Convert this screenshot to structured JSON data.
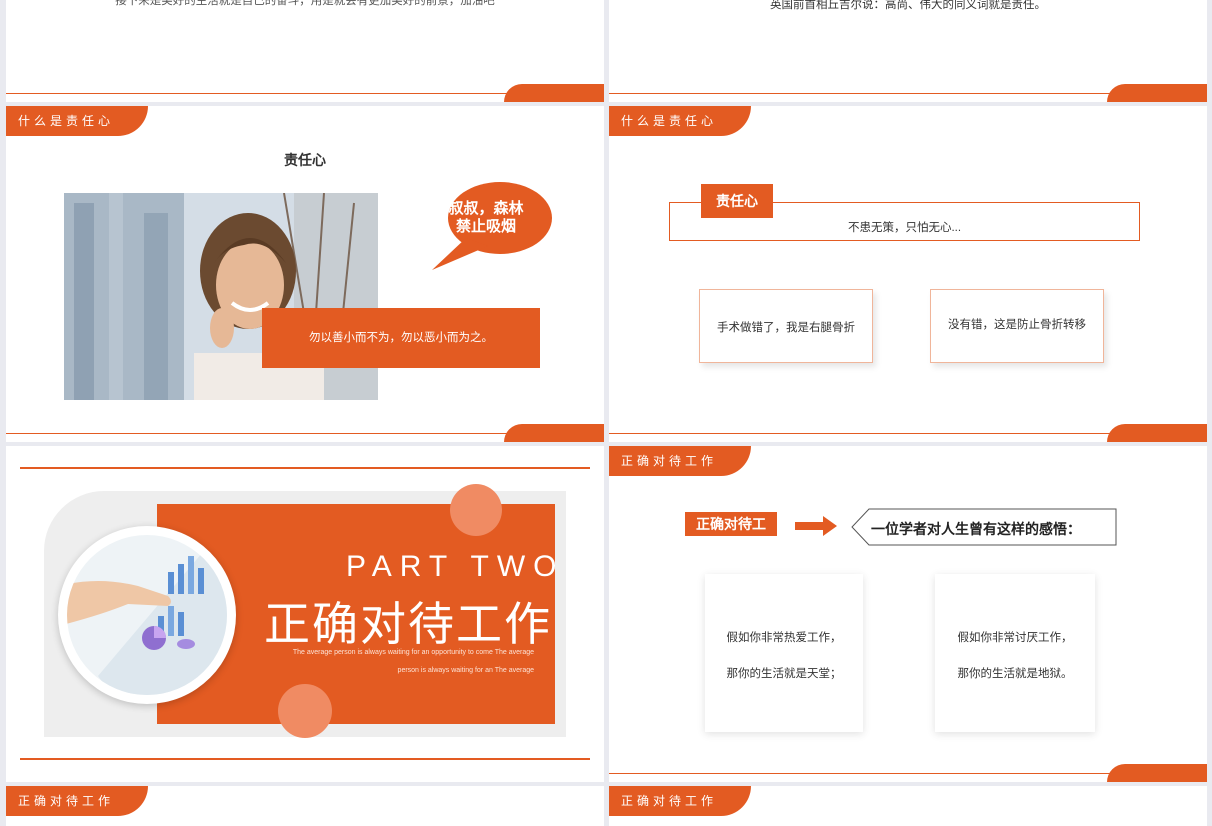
{
  "slides": {
    "s1": {
      "text": "英国前首相丘吉尔说：高尚、伟大的同义词就是责任。"
    },
    "s0": {
      "text": "接下来是美好的生活就是自己的奋斗，用是就会有更加美好的前景，加油吧"
    },
    "s3": {
      "tag": "什么是责任心",
      "title": "责任心",
      "bubble_line1": "叔叔，森林",
      "bubble_line2": "禁止吸烟",
      "quote": "勿以善小而不为，勿以恶小而为之。"
    },
    "s4": {
      "tag": "什么是责任心",
      "label": "责任心",
      "subtitle": "不患无策，只怕无心...",
      "card1": "手术做错了，我是右腿骨折",
      "card2": "没有错，这是防止骨折转移"
    },
    "s5": {
      "part": "PART TWO",
      "title": "正确对待工作",
      "en_line1": "The average person is always waiting for an opportunity to come The average",
      "en_line2": "person is always waiting for an The average"
    },
    "s6": {
      "tag": "正确对待工作",
      "label": "正确对待工",
      "heading": "一位学者对人生曾有这样的感悟：",
      "card1_line1": "假如你非常热爱工作，",
      "card1_line2": "那你的生活就是天堂；",
      "card2_line1": "假如你非常讨厌工作，",
      "card2_line2": "那你的生活就是地狱。"
    },
    "s7": {
      "tag": "正确对待工作"
    },
    "s8": {
      "tag": "正确对待工作"
    }
  },
  "colors": {
    "accent": "#e35b22",
    "background": "#e9eaf0"
  }
}
